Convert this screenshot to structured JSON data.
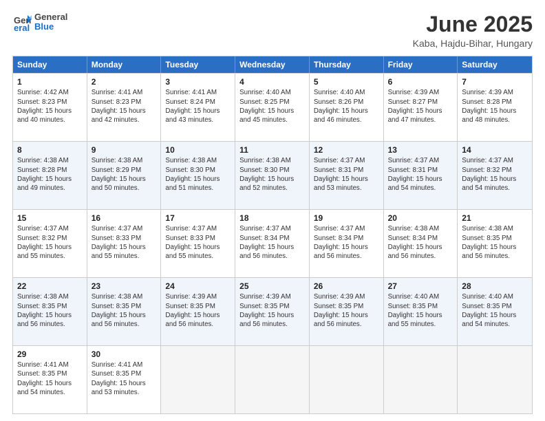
{
  "header": {
    "logo_general": "General",
    "logo_blue": "Blue",
    "month_year": "June 2025",
    "location": "Kaba, Hajdu-Bihar, Hungary"
  },
  "weekdays": [
    "Sunday",
    "Monday",
    "Tuesday",
    "Wednesday",
    "Thursday",
    "Friday",
    "Saturday"
  ],
  "rows": [
    [
      {
        "day": "1",
        "sunrise": "Sunrise: 4:42 AM",
        "sunset": "Sunset: 8:23 PM",
        "daylight": "Daylight: 15 hours and 40 minutes."
      },
      {
        "day": "2",
        "sunrise": "Sunrise: 4:41 AM",
        "sunset": "Sunset: 8:23 PM",
        "daylight": "Daylight: 15 hours and 42 minutes."
      },
      {
        "day": "3",
        "sunrise": "Sunrise: 4:41 AM",
        "sunset": "Sunset: 8:24 PM",
        "daylight": "Daylight: 15 hours and 43 minutes."
      },
      {
        "day": "4",
        "sunrise": "Sunrise: 4:40 AM",
        "sunset": "Sunset: 8:25 PM",
        "daylight": "Daylight: 15 hours and 45 minutes."
      },
      {
        "day": "5",
        "sunrise": "Sunrise: 4:40 AM",
        "sunset": "Sunset: 8:26 PM",
        "daylight": "Daylight: 15 hours and 46 minutes."
      },
      {
        "day": "6",
        "sunrise": "Sunrise: 4:39 AM",
        "sunset": "Sunset: 8:27 PM",
        "daylight": "Daylight: 15 hours and 47 minutes."
      },
      {
        "day": "7",
        "sunrise": "Sunrise: 4:39 AM",
        "sunset": "Sunset: 8:28 PM",
        "daylight": "Daylight: 15 hours and 48 minutes."
      }
    ],
    [
      {
        "day": "8",
        "sunrise": "Sunrise: 4:38 AM",
        "sunset": "Sunset: 8:28 PM",
        "daylight": "Daylight: 15 hours and 49 minutes."
      },
      {
        "day": "9",
        "sunrise": "Sunrise: 4:38 AM",
        "sunset": "Sunset: 8:29 PM",
        "daylight": "Daylight: 15 hours and 50 minutes."
      },
      {
        "day": "10",
        "sunrise": "Sunrise: 4:38 AM",
        "sunset": "Sunset: 8:30 PM",
        "daylight": "Daylight: 15 hours and 51 minutes."
      },
      {
        "day": "11",
        "sunrise": "Sunrise: 4:38 AM",
        "sunset": "Sunset: 8:30 PM",
        "daylight": "Daylight: 15 hours and 52 minutes."
      },
      {
        "day": "12",
        "sunrise": "Sunrise: 4:37 AM",
        "sunset": "Sunset: 8:31 PM",
        "daylight": "Daylight: 15 hours and 53 minutes."
      },
      {
        "day": "13",
        "sunrise": "Sunrise: 4:37 AM",
        "sunset": "Sunset: 8:31 PM",
        "daylight": "Daylight: 15 hours and 54 minutes."
      },
      {
        "day": "14",
        "sunrise": "Sunrise: 4:37 AM",
        "sunset": "Sunset: 8:32 PM",
        "daylight": "Daylight: 15 hours and 54 minutes."
      }
    ],
    [
      {
        "day": "15",
        "sunrise": "Sunrise: 4:37 AM",
        "sunset": "Sunset: 8:32 PM",
        "daylight": "Daylight: 15 hours and 55 minutes."
      },
      {
        "day": "16",
        "sunrise": "Sunrise: 4:37 AM",
        "sunset": "Sunset: 8:33 PM",
        "daylight": "Daylight: 15 hours and 55 minutes."
      },
      {
        "day": "17",
        "sunrise": "Sunrise: 4:37 AM",
        "sunset": "Sunset: 8:33 PM",
        "daylight": "Daylight: 15 hours and 55 minutes."
      },
      {
        "day": "18",
        "sunrise": "Sunrise: 4:37 AM",
        "sunset": "Sunset: 8:34 PM",
        "daylight": "Daylight: 15 hours and 56 minutes."
      },
      {
        "day": "19",
        "sunrise": "Sunrise: 4:37 AM",
        "sunset": "Sunset: 8:34 PM",
        "daylight": "Daylight: 15 hours and 56 minutes."
      },
      {
        "day": "20",
        "sunrise": "Sunrise: 4:38 AM",
        "sunset": "Sunset: 8:34 PM",
        "daylight": "Daylight: 15 hours and 56 minutes."
      },
      {
        "day": "21",
        "sunrise": "Sunrise: 4:38 AM",
        "sunset": "Sunset: 8:35 PM",
        "daylight": "Daylight: 15 hours and 56 minutes."
      }
    ],
    [
      {
        "day": "22",
        "sunrise": "Sunrise: 4:38 AM",
        "sunset": "Sunset: 8:35 PM",
        "daylight": "Daylight: 15 hours and 56 minutes."
      },
      {
        "day": "23",
        "sunrise": "Sunrise: 4:38 AM",
        "sunset": "Sunset: 8:35 PM",
        "daylight": "Daylight: 15 hours and 56 minutes."
      },
      {
        "day": "24",
        "sunrise": "Sunrise: 4:39 AM",
        "sunset": "Sunset: 8:35 PM",
        "daylight": "Daylight: 15 hours and 56 minutes."
      },
      {
        "day": "25",
        "sunrise": "Sunrise: 4:39 AM",
        "sunset": "Sunset: 8:35 PM",
        "daylight": "Daylight: 15 hours and 56 minutes."
      },
      {
        "day": "26",
        "sunrise": "Sunrise: 4:39 AM",
        "sunset": "Sunset: 8:35 PM",
        "daylight": "Daylight: 15 hours and 56 minutes."
      },
      {
        "day": "27",
        "sunrise": "Sunrise: 4:40 AM",
        "sunset": "Sunset: 8:35 PM",
        "daylight": "Daylight: 15 hours and 55 minutes."
      },
      {
        "day": "28",
        "sunrise": "Sunrise: 4:40 AM",
        "sunset": "Sunset: 8:35 PM",
        "daylight": "Daylight: 15 hours and 54 minutes."
      }
    ],
    [
      {
        "day": "29",
        "sunrise": "Sunrise: 4:41 AM",
        "sunset": "Sunset: 8:35 PM",
        "daylight": "Daylight: 15 hours and 54 minutes."
      },
      {
        "day": "30",
        "sunrise": "Sunrise: 4:41 AM",
        "sunset": "Sunset: 8:35 PM",
        "daylight": "Daylight: 15 hours and 53 minutes."
      },
      {
        "day": "",
        "sunrise": "",
        "sunset": "",
        "daylight": ""
      },
      {
        "day": "",
        "sunrise": "",
        "sunset": "",
        "daylight": ""
      },
      {
        "day": "",
        "sunrise": "",
        "sunset": "",
        "daylight": ""
      },
      {
        "day": "",
        "sunrise": "",
        "sunset": "",
        "daylight": ""
      },
      {
        "day": "",
        "sunrise": "",
        "sunset": "",
        "daylight": ""
      }
    ]
  ]
}
